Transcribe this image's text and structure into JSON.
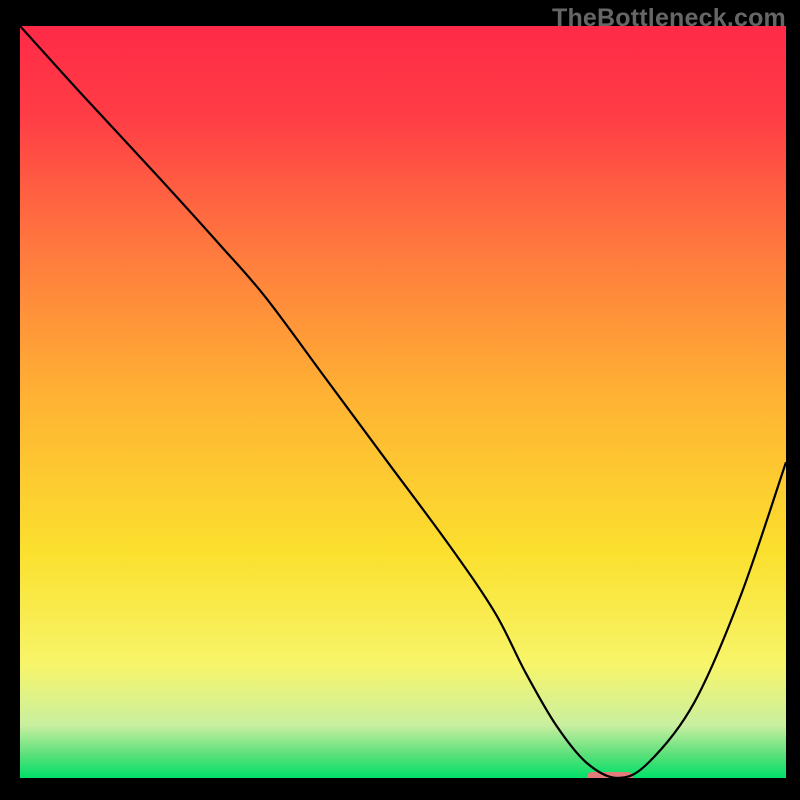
{
  "watermark": "TheBottleneck.com",
  "chart_data": {
    "type": "line",
    "title": "",
    "xlabel": "",
    "ylabel": "",
    "xlim": [
      0,
      100
    ],
    "ylim": [
      0,
      100
    ],
    "background_gradient": {
      "stops": [
        {
          "offset": 0.0,
          "color": "#ff2a47"
        },
        {
          "offset": 0.12,
          "color": "#ff3d46"
        },
        {
          "offset": 0.3,
          "color": "#ff7a3e"
        },
        {
          "offset": 0.5,
          "color": "#ffb433"
        },
        {
          "offset": 0.7,
          "color": "#fbe02e"
        },
        {
          "offset": 0.85,
          "color": "#f7f56a"
        },
        {
          "offset": 0.93,
          "color": "#c9efa0"
        },
        {
          "offset": 0.97,
          "color": "#57e07a"
        },
        {
          "offset": 1.0,
          "color": "#00e06a"
        }
      ]
    },
    "series": [
      {
        "name": "bottleneck-curve",
        "color": "#000000",
        "x": [
          0,
          8,
          18,
          26,
          32,
          40,
          48,
          56,
          62,
          66,
          70,
          74,
          78,
          82,
          88,
          94,
          100
        ],
        "values": [
          100,
          91,
          80,
          71,
          64,
          53,
          42,
          31,
          22,
          14,
          7,
          2,
          0,
          2,
          10,
          24,
          42
        ]
      }
    ],
    "marker": {
      "name": "optimal-zone",
      "x_start": 74,
      "x_end": 80,
      "y": 0,
      "color": "#e47a7a"
    }
  }
}
